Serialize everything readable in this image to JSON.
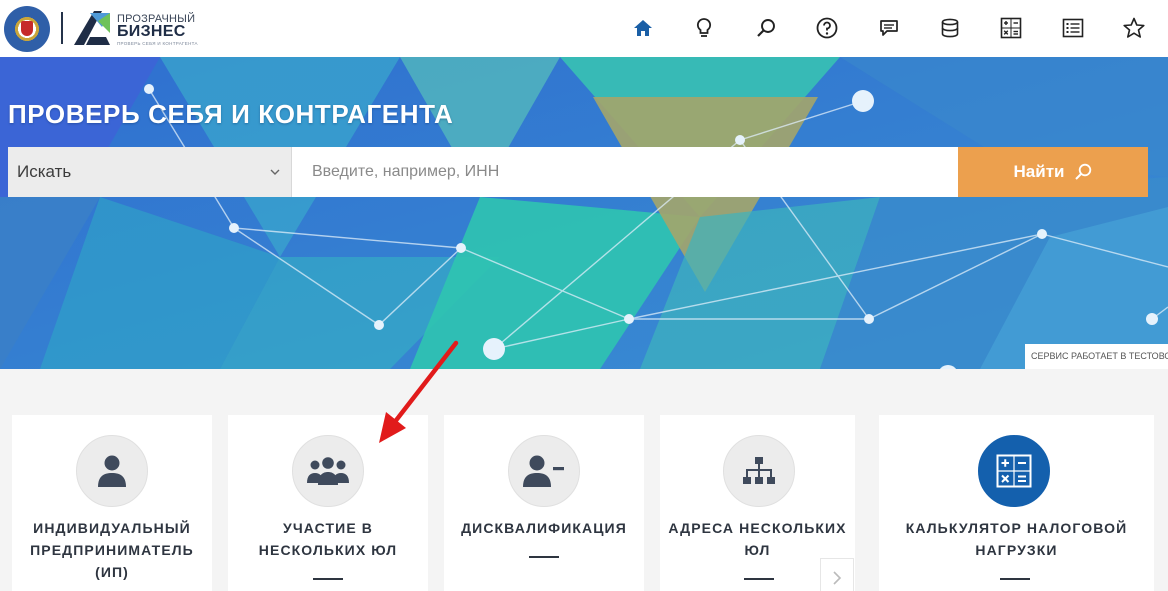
{
  "header": {
    "brand_top": "ПРОЗРАЧНЫЙ",
    "brand_main": "БИЗНЕС",
    "brand_sub": "ПРОВЕРЬ СЕБЯ И КОНТРАГЕНТА",
    "nav_icons": [
      "home-icon",
      "lightbulb-icon",
      "search-icon",
      "help-icon",
      "chat-icon",
      "database-icon",
      "calculator-icon",
      "list-icon",
      "star-icon"
    ],
    "active_color": "#1a5fa6"
  },
  "hero": {
    "title": "ПРОВЕРЬ СЕБЯ И КОНТРАГЕНТА",
    "search": {
      "select_value": "Искать",
      "placeholder": "Введите, например, ИНН",
      "button_label": "Найти"
    },
    "test_badge": "СЕРВИС РАБОТАЕТ В ТЕСТОВОМ РЕЖИМЕ",
    "button_color": "#eca04e"
  },
  "cards": [
    {
      "label": "ИНДИВИДУАЛЬНЫЙ ПРЕДПРИНИМАТЕЛЬ (ИП)",
      "icon": "person-icon"
    },
    {
      "label": "УЧАСТИЕ В НЕСКОЛЬКИХ ЮЛ",
      "icon": "group-icon"
    },
    {
      "label": "ДИСКВАЛИФИКАЦИЯ",
      "icon": "person-minus-icon"
    },
    {
      "label": "АДРЕСА НЕСКОЛЬКИХ ЮЛ",
      "icon": "hierarchy-icon"
    },
    {
      "label": "КАЛЬКУЛЯТОР НАЛОГОВОЙ НАГРУЗКИ",
      "icon": "calculator-icon",
      "active": true
    }
  ]
}
